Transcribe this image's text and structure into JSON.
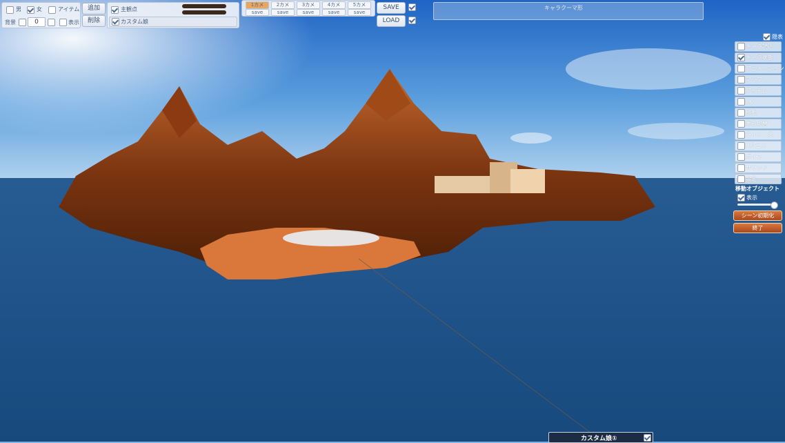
{
  "toolbar": {
    "row1": {
      "check1_label": "男",
      "check2_label": "女",
      "check3_label": "アイテム",
      "add_label": "追加",
      "main_check_label": "主観点"
    },
    "row2": {
      "bg_label": "背景",
      "bg_value": "0",
      "show_label": "表示",
      "delete_label": "削除",
      "custom_field": "カスタム娘"
    },
    "cam_slots": [
      "1カメ",
      "2カメ",
      "3カメ",
      "4カメ",
      "5カメ"
    ],
    "slot_save_label": "save",
    "save_label": "SAVE",
    "load_label": "LOAD"
  },
  "top_bar": {
    "label": "キャラクーマ形"
  },
  "menu": {
    "hide_label": "隠表",
    "items": [
      {
        "label": "キャラ読込",
        "checked": false
      },
      {
        "label": "キャラ状態",
        "checked": true
      },
      {
        "label": "アニメーション",
        "checked": false
      },
      {
        "label": "マップ",
        "checked": false
      },
      {
        "label": "アイテム",
        "checked": false
      },
      {
        "label": "I K",
        "checked": false
      },
      {
        "label": "移動",
        "checked": false
      },
      {
        "label": "表示切替",
        "checked": false
      },
      {
        "label": "ライト　変",
        "checked": false
      },
      {
        "label": "Hアニメ",
        "checked": false
      },
      {
        "label": "ボイス",
        "checked": false
      },
      {
        "label": "サウンド",
        "checked": false
      },
      {
        "label": "設定",
        "checked": false
      }
    ],
    "move_object_label": "移動オブジェクト",
    "move_show_label": "表示",
    "orange_btn1": "シーン初期化",
    "orange_btn2": "終了"
  },
  "bottom_bar": {
    "label": "カスタム娘①"
  },
  "colors": {
    "sky": "#4d8fd6",
    "sea": "#1f4f86",
    "terrain": "#6b2d0c",
    "accent_orange": "#c9602b"
  }
}
